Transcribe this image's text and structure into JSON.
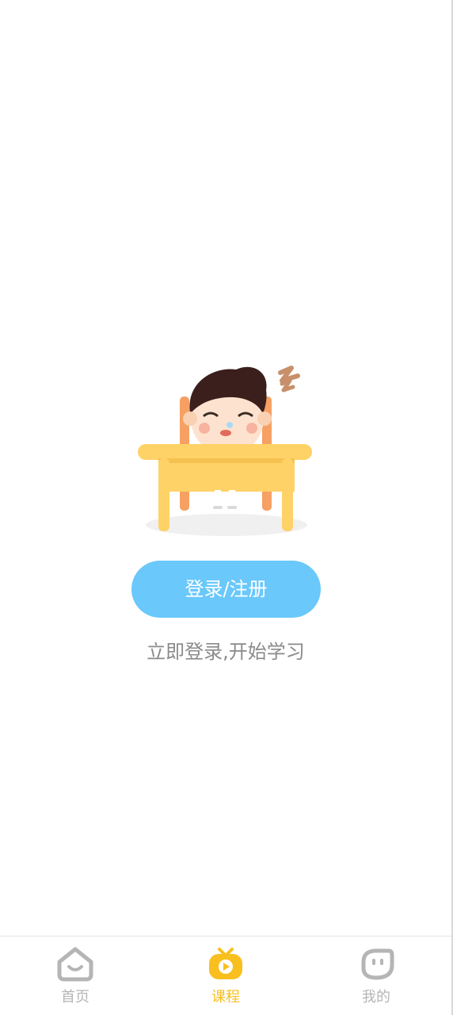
{
  "main": {
    "illustration_name": "sleeping-student-at-desk",
    "login_button_label": "登录/注册",
    "hint_text": "立即登录,开始学习"
  },
  "tabbar": {
    "active_color": "#f9bf1e",
    "inactive_color": "#b5b5b5",
    "items": [
      {
        "label": "首页",
        "icon": "home-icon",
        "active": false
      },
      {
        "label": "课程",
        "icon": "course-tv-icon",
        "active": true
      },
      {
        "label": "我的",
        "icon": "profile-icon",
        "active": false
      }
    ]
  }
}
